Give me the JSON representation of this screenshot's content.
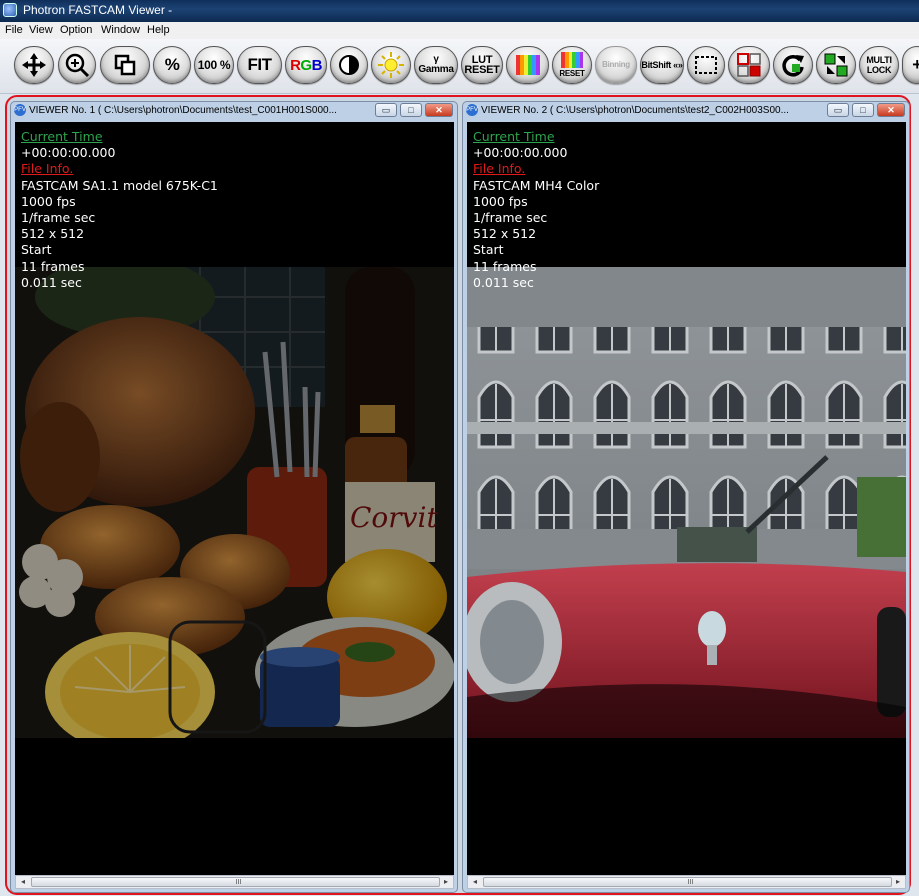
{
  "window": {
    "title": "Photron FASTCAM Viewer -"
  },
  "menu": [
    "File",
    "View",
    "Option",
    "Window",
    "Help"
  ],
  "toolbar": {
    "buttons": [
      {
        "name": "move",
        "label": "✥"
      },
      {
        "name": "zoom",
        "label": "⊕"
      },
      {
        "name": "overlay",
        "label": "⧉"
      },
      {
        "name": "percent",
        "label": "%"
      },
      {
        "name": "100-percent",
        "label": "100 %"
      },
      {
        "name": "fit",
        "label": "FIT"
      },
      {
        "name": "rgb",
        "label": "RGB"
      },
      {
        "name": "contrast",
        "label": "◑"
      },
      {
        "name": "brightness",
        "label": "☀"
      },
      {
        "name": "gamma",
        "label": "γ Gamma"
      },
      {
        "name": "lut-reset",
        "label": "LUT RESET"
      },
      {
        "name": "color-bars",
        "label": ""
      },
      {
        "name": "reset",
        "label": "RESET"
      },
      {
        "name": "binning",
        "label": "Binning"
      },
      {
        "name": "bitshift",
        "label": "BitShift «»"
      },
      {
        "name": "select-rect",
        "label": ""
      },
      {
        "name": "split",
        "label": ""
      },
      {
        "name": "rotate",
        "label": ""
      },
      {
        "name": "swap",
        "label": ""
      },
      {
        "name": "multi-lock",
        "label": "MULTI LOCK"
      }
    ]
  },
  "viewers": [
    {
      "title": "VIEWER No. 1 ( C:\\Users\\photron\\Documents\\test_C001H001S000...",
      "hud": {
        "current_time_label": "Current Time",
        "current_time": "+00:00:00.000",
        "file_info_label": "File Info.",
        "camera": "FASTCAM SA1.1 model 675K-C1",
        "fps": "1000 fps",
        "shutter": "1/frame sec",
        "resolution": "512 x 512",
        "trigger": "Start",
        "frames": "11 frames",
        "duration": "0.011 sec"
      },
      "image": "still-life-food-photo"
    },
    {
      "title": "VIEWER No. 2 ( C:\\Users\\photron\\Documents\\test2_C002H003S00...",
      "hud": {
        "current_time_label": "Current Time",
        "current_time": "+00:00:00.000",
        "file_info_label": "File Info.",
        "camera": "FASTCAM MH4 Color",
        "fps": "1000 fps",
        "shutter": "1/frame sec",
        "resolution": "512 x 512",
        "trigger": "Start",
        "frames": "11 frames",
        "duration": "0.011 sec"
      },
      "image": "parliament-building-red-car-photo"
    }
  ],
  "colors": {
    "highlight_border": "#e0141e",
    "hud_green": "#2ea44e",
    "hud_red": "#e01a1a"
  },
  "scrollbar": {
    "grip": "III"
  }
}
